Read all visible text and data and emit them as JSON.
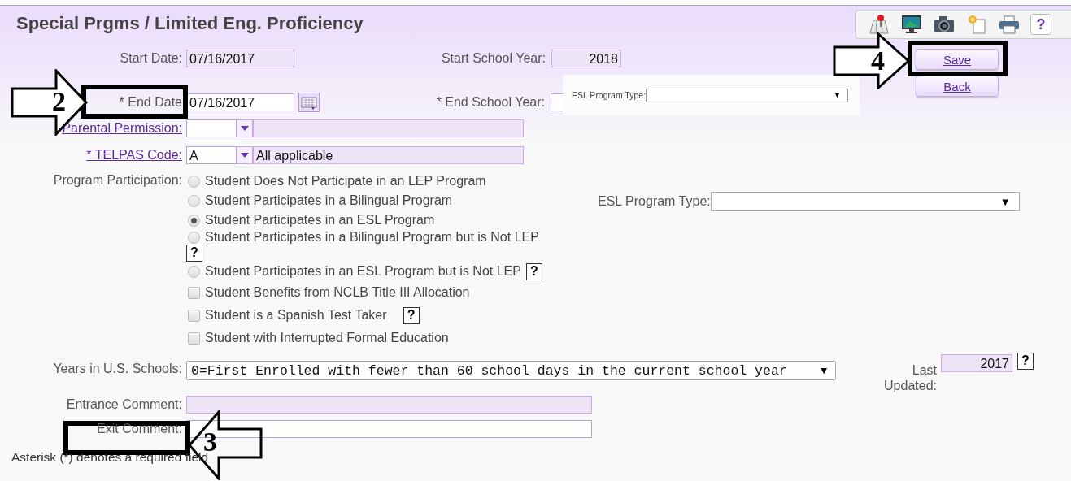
{
  "page_title": "Special Prgms / Limited Eng. Proficiency",
  "toolbar": {
    "help": "?"
  },
  "start_date": {
    "label": "Start Date:",
    "value": "07/16/2017"
  },
  "start_school_year": {
    "label": "Start School Year:",
    "value": "2018"
  },
  "end_date": {
    "label": "* End Date",
    "value": "07/16/2017"
  },
  "end_school_year": {
    "label": "* End School Year:"
  },
  "popup": {
    "label": "ESL Program Type:",
    "arrow": "▼"
  },
  "buttons": [
    {
      "label": "Save"
    },
    {
      "label": "Back"
    }
  ],
  "parental_permission": {
    "label": "Parental Permission:"
  },
  "telpas_code": {
    "label": "* TELPAS Code:",
    "code": "A",
    "description": "All applicable"
  },
  "program_participation": {
    "label": "Program Participation:",
    "radios": [
      {
        "label": "Student Does Not Participate in an LEP Program",
        "selected": false
      },
      {
        "label": "Student Participates in a Bilingual Program",
        "selected": false
      },
      {
        "label": "Student Participates in an ESL Program",
        "selected": true
      },
      {
        "label": "Student Participates in a Bilingual Program but is Not LEP",
        "selected": false,
        "help": "?"
      },
      {
        "label": "Student Participates in an ESL Program but is Not LEP",
        "selected": false,
        "help": "?"
      }
    ],
    "checkboxes": [
      {
        "label": "Student Benefits from NCLB Title III Allocation",
        "checked": false
      },
      {
        "label": "Student is a Spanish Test Taker",
        "checked": false,
        "help": "?"
      },
      {
        "label": "Student with Interrupted Formal Education",
        "checked": false
      }
    ]
  },
  "esl_program_type": {
    "label": "ESL Program Type:",
    "arrow": "▼"
  },
  "years_in_us_schools": {
    "label": "Years in U.S. Schools:",
    "value": "0=First Enrolled with fewer than 60 school days in the current school year",
    "arrow": "▼"
  },
  "last_updated": {
    "label": "Last Updated:",
    "value": "2017",
    "help": "?"
  },
  "entrance_comment": {
    "label": "Entrance Comment:"
  },
  "exit_comment": {
    "label": "Exit Comment:"
  },
  "footnote": "Asterisk (*) denotes a required field",
  "annotations": [
    {
      "number": "2"
    },
    {
      "number": "4"
    },
    {
      "number": "3"
    }
  ]
}
